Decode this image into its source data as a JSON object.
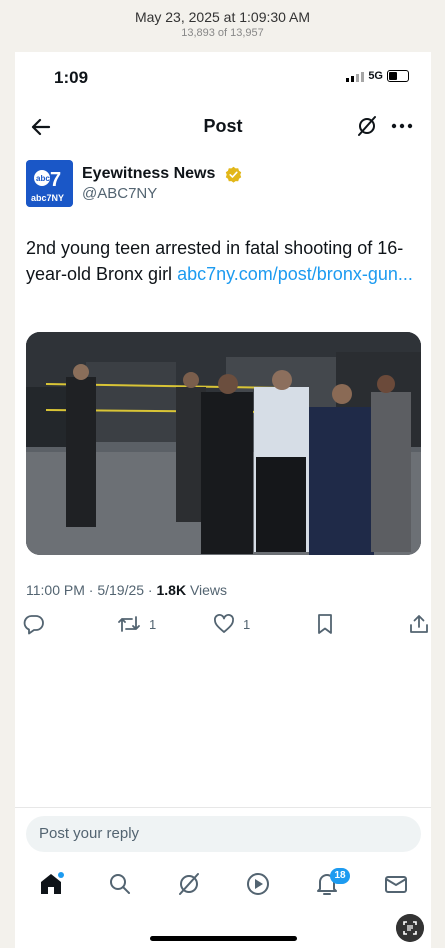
{
  "screenshot_header": {
    "date": "May 23, 2025 at 1:09:30 AM",
    "count": "13,893 of 13,957"
  },
  "status_bar": {
    "time": "1:09",
    "network": "5G"
  },
  "header": {
    "title": "Post",
    "back_icon": "arrow-left-icon",
    "grok_icon": "grok-icon",
    "more_icon": "more-horizontal-icon"
  },
  "author": {
    "name": "Eyewitness News",
    "handle": "@ABC7NY",
    "logo_top": "abc",
    "logo_bottom": "abc7NY",
    "logo_seven": "7"
  },
  "post": {
    "text": "2nd young teen arrested in fatal shooting of 16-year-old Bronx girl ",
    "link": "abc7ny.com/post/bronx-gun..."
  },
  "meta": {
    "time_date": "11:00 PM · 5/19/25 · ",
    "views_count": "1.8K",
    "views_label": " Views"
  },
  "actions": {
    "reply_count": "",
    "retweet_count": "1",
    "like_count": "1"
  },
  "reply_box": {
    "placeholder": "Post your reply"
  },
  "tabbar": {
    "notifications_badge": "18"
  },
  "colors": {
    "accent": "#1d9bf0",
    "verified_gold": "#e2b719",
    "abc_blue": "#1a57c7"
  }
}
